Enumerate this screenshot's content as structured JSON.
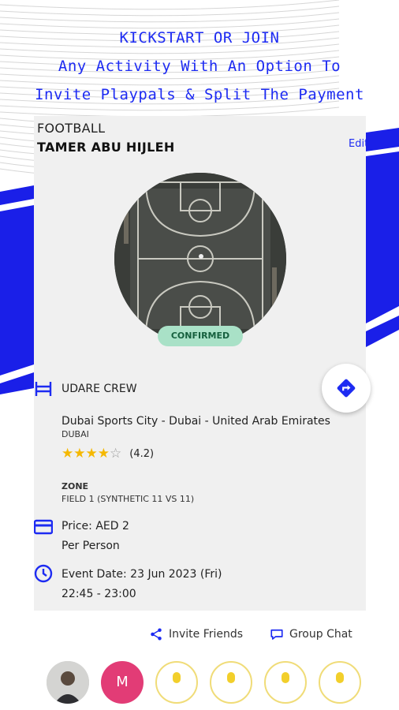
{
  "headline": {
    "line1": "KICKSTART OR JOIN",
    "line2": "Any Activity With An Option To",
    "line3": "Invite Playpals & Split The Payment"
  },
  "card": {
    "sport": "FOOTBALL",
    "owner": "TAMER ABU HIJLEH",
    "edit_label": "Edit",
    "status_badge": "CONFIRMED",
    "venue_name": "UDARE CREW",
    "address": "Dubai Sports City - Dubai - United Arab Emirates",
    "city": "DUBAI",
    "rating": {
      "value": 4.2,
      "label": "(4.2)",
      "stars_filled": 4,
      "stars_total": 5
    },
    "zone_label": "ZONE",
    "zone_value": "FIELD 1 (SYNTHETIC 11 VS 11)",
    "price": "Price: AED 2",
    "price_unit": "Per Person",
    "event_date": "Event Date: 23 Jun 2023 (Fri)",
    "event_time": "22:45 - 23:00"
  },
  "actions": {
    "invite_label": "Invite Friends",
    "chat_label": "Group Chat"
  },
  "participants": {
    "second_initial": "M"
  },
  "colors": {
    "brand_blue": "#1d2bf2",
    "confirmed_bg": "#a9e1c7",
    "star": "#f5b800",
    "invite_slot": "#f2cf2b",
    "avatar_pink": "#e23c76"
  },
  "icons": [
    "directions-icon",
    "venue-icon",
    "price-card-icon",
    "clock-icon",
    "share-icon",
    "chat-icon",
    "star-icon"
  ]
}
